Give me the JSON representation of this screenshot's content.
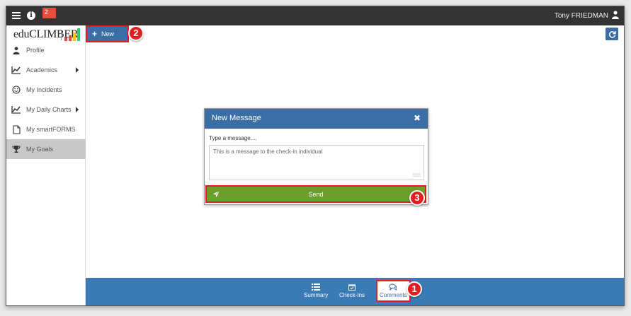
{
  "topbar": {
    "notification_count": "2",
    "user_name": "Tony FRIEDMAN"
  },
  "sidebar": {
    "logo_text": "eduCLIMBER",
    "items": [
      {
        "label": "Profile",
        "icon": "user-icon"
      },
      {
        "label": "Academics",
        "icon": "chart-line-icon",
        "submenu": true
      },
      {
        "label": "My Incidents",
        "icon": "smiley-icon"
      },
      {
        "label": "My Daily Charts",
        "icon": "chart-line-icon",
        "submenu": true
      },
      {
        "label": "My smartFORMS",
        "icon": "document-icon"
      },
      {
        "label": "My Goals",
        "icon": "trophy-icon",
        "active": true
      }
    ]
  },
  "toolbar": {
    "new_label": "New"
  },
  "modal": {
    "title": "New Message",
    "field_label": "Type a message....",
    "message_value": "This is a message to the check-in individual",
    "char_count": "956",
    "send_label": "Send"
  },
  "footer": {
    "tabs": [
      {
        "label": "Summary",
        "icon": "list-icon"
      },
      {
        "label": "Check-Ins",
        "icon": "calendar-check-icon"
      },
      {
        "label": "Comments",
        "icon": "comments-icon",
        "active": true
      }
    ]
  },
  "callouts": [
    "1",
    "2",
    "3"
  ],
  "colors": {
    "topbar": "#333333",
    "primary": "#3a6ea5",
    "footer": "#3a7ab5",
    "send": "#6b9e2a",
    "callout": "#e02020",
    "active_nav": "#c8c8c8"
  }
}
